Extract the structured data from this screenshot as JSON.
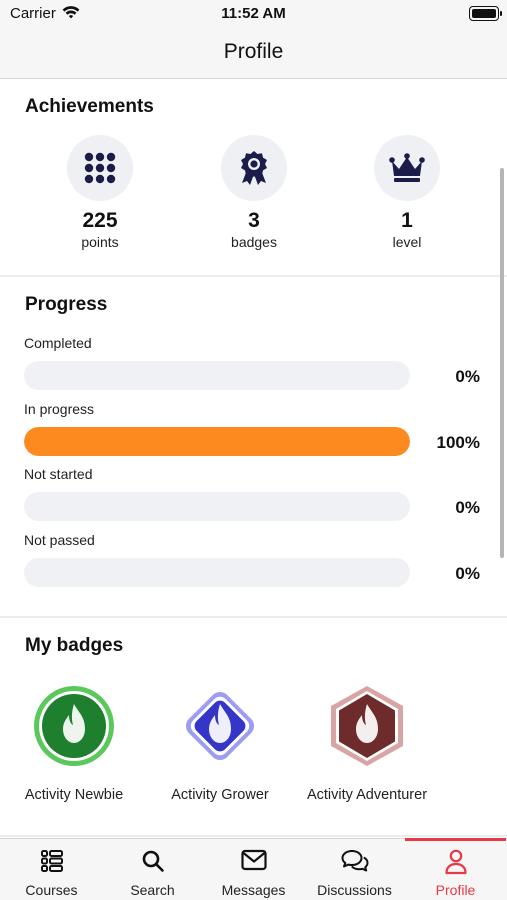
{
  "status_bar": {
    "carrier": "Carrier",
    "time": "11:52 AM"
  },
  "header": {
    "title": "Profile"
  },
  "achievements": {
    "title": "Achievements",
    "items": [
      {
        "value": "225",
        "label": "points",
        "icon": "grid-dots-icon"
      },
      {
        "value": "3",
        "label": "badges",
        "icon": "award-ribbon-icon"
      },
      {
        "value": "1",
        "label": "level",
        "icon": "crown-icon"
      }
    ]
  },
  "progress": {
    "title": "Progress",
    "accent_color": "#fc8a1e",
    "items": [
      {
        "label": "Completed",
        "percent": 0,
        "percent_text": "0%"
      },
      {
        "label": "In progress",
        "percent": 100,
        "percent_text": "100%"
      },
      {
        "label": "Not started",
        "percent": 0,
        "percent_text": "0%"
      },
      {
        "label": "Not passed",
        "percent": 0,
        "percent_text": "0%"
      }
    ]
  },
  "badges": {
    "title": "My badges",
    "items": [
      {
        "label": "Activity Newbie",
        "shape": "circle",
        "color": "#1e7f2e",
        "ring": "#5ac85a"
      },
      {
        "label": "Activity Grower",
        "shape": "diamond",
        "color": "#3535c8",
        "ring": "#9c9cf2"
      },
      {
        "label": "Activity Adventurer",
        "shape": "hexagon",
        "color": "#6e2b2b",
        "ring": "#d9a4a4"
      }
    ]
  },
  "tab_bar": {
    "active_color": "#e63946",
    "tabs": [
      {
        "label": "Courses",
        "icon": "courses-list-icon",
        "active": false
      },
      {
        "label": "Search",
        "icon": "search-icon",
        "active": false
      },
      {
        "label": "Messages",
        "icon": "envelope-icon",
        "active": false
      },
      {
        "label": "Discussions",
        "icon": "chat-bubbles-icon",
        "active": false
      },
      {
        "label": "Profile",
        "icon": "user-icon",
        "active": true
      }
    ]
  }
}
